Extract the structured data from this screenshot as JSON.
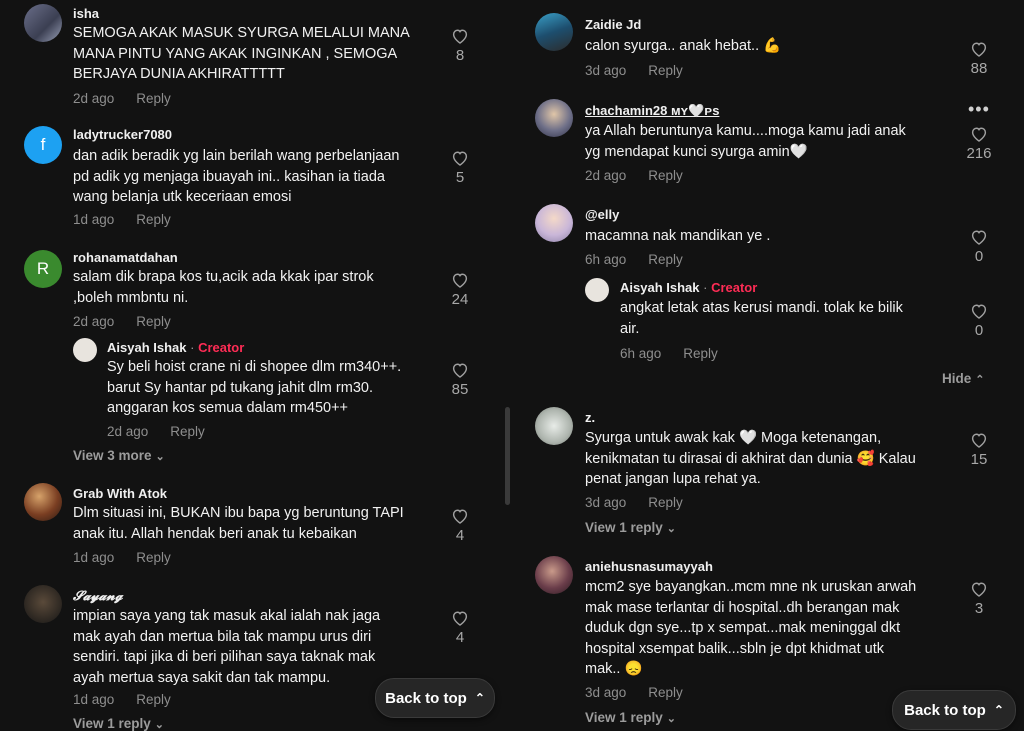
{
  "ui": {
    "reply_label": "Reply",
    "creator_badge": "Creator",
    "separator": " · ",
    "back_to_top": "Back to top",
    "hide_label": "Hide"
  },
  "left": [
    {
      "user": "isha",
      "lines": [
        "SEMOGA AKAK MASUK SYURGA MELALUI MANA",
        "MANA PINTU YANG AKAK INGINKAN , SEMOGA",
        "BERJAYA DUNIA AKHIRATTTTT"
      ],
      "time": "2d ago",
      "likes": "8"
    },
    {
      "user": "ladytrucker7080",
      "avatar_letter": "f",
      "lines": [
        "dan adik beradik yg lain berilah wang perbelanjaan",
        "pd adik yg menjaga ibuayah ini.. kasihan ia tiada",
        "wang belanja utk keceriaan emosi"
      ],
      "time": "1d ago",
      "likes": "5"
    },
    {
      "user": "rohanamatdahan",
      "avatar_letter": "R",
      "lines": [
        "salam dik brapa kos tu,acik ada kkak ipar strok",
        ",boleh mmbntu ni."
      ],
      "time": "2d ago",
      "likes": "24",
      "reply": {
        "user": "Aisyah Ishak",
        "lines": [
          "Sy beli hoist crane ni di shopee dlm rm340++.",
          "barut Sy hantar pd tukang jahit dlm rm30.",
          "anggaran kos semua dalam rm450++"
        ],
        "time": "2d ago",
        "likes": "85"
      },
      "view_more": "View 3 more"
    },
    {
      "user": "Grab With Atok",
      "lines": [
        "Dlm situasi ini, BUKAN ibu bapa yg beruntung TAPI",
        "anak itu. Allah hendak beri anak tu kebaikan"
      ],
      "time": "1d ago",
      "likes": "4"
    },
    {
      "user": "𝓢𝓪𝔂𝓪𝓷𝓰",
      "lines": [
        "impian saya yang tak masuk akal ialah nak jaga",
        "mak ayah dan mertua bila tak mampu urus diri",
        "sendiri. tapi jika di beri pilihan saya taknak mak",
        "ayah mertua saya sakit dan tak mampu."
      ],
      "time": "1d ago",
      "likes": "4",
      "view_more": "View 1 reply"
    }
  ],
  "right": [
    {
      "user": "Zaidie Jd",
      "lines": [
        "calon syurga.. anak hebat.. 💪"
      ],
      "time": "3d ago",
      "likes": "88"
    },
    {
      "user": "chachamin28 ᴍʏ🤍ᴘs",
      "lines": [
        "ya Allah beruntunya kamu....moga kamu jadi anak",
        "yg mendapat kunci syurga amin🤍"
      ],
      "time": "2d ago",
      "likes": "216"
    },
    {
      "user": "@elly",
      "lines": [
        "macamna nak mandikan ye ."
      ],
      "time": "6h ago",
      "likes": "0",
      "reply": {
        "user": "Aisyah Ishak",
        "lines": [
          "angkat letak atas kerusi mandi. tolak ke bilik",
          "air."
        ],
        "time": "6h ago",
        "likes": "0"
      }
    },
    {
      "user": "z.",
      "lines": [
        "Syurga untuk awak kak 🤍  Moga ketenangan,",
        "kenikmatan tu dirasai di akhirat dan dunia 🥰 Kalau",
        "penat jangan lupa rehat ya."
      ],
      "time": "3d ago",
      "likes": "15",
      "view_more": "View 1 reply"
    },
    {
      "user": "aniehusnasumayyah",
      "lines": [
        "mcm2 sye bayangkan..mcm mne nk uruskan arwah",
        "mak mase terlantar di hospital..dh berangan mak",
        "duduk dgn sye...tp x sempat...mak meninggal dkt",
        "hospital xsempat balik...sbln je dpt khidmat utk",
        "mak.. 😞"
      ],
      "time": "3d ago",
      "likes": "3",
      "view_more": "View 1 reply"
    }
  ],
  "colors": {
    "background": "#121212",
    "creator": "#fe2c55",
    "muted": "#8e8e8e",
    "ladytrucker_avatar": "#1da1f2",
    "rohana_avatar": "#3a8a2e"
  },
  "icons": {
    "like": "heart-outline-icon",
    "chevron": "chevron-down-icon",
    "back_to_top": "double-chevron-up-icon",
    "more": "more-horizontal-icon"
  }
}
